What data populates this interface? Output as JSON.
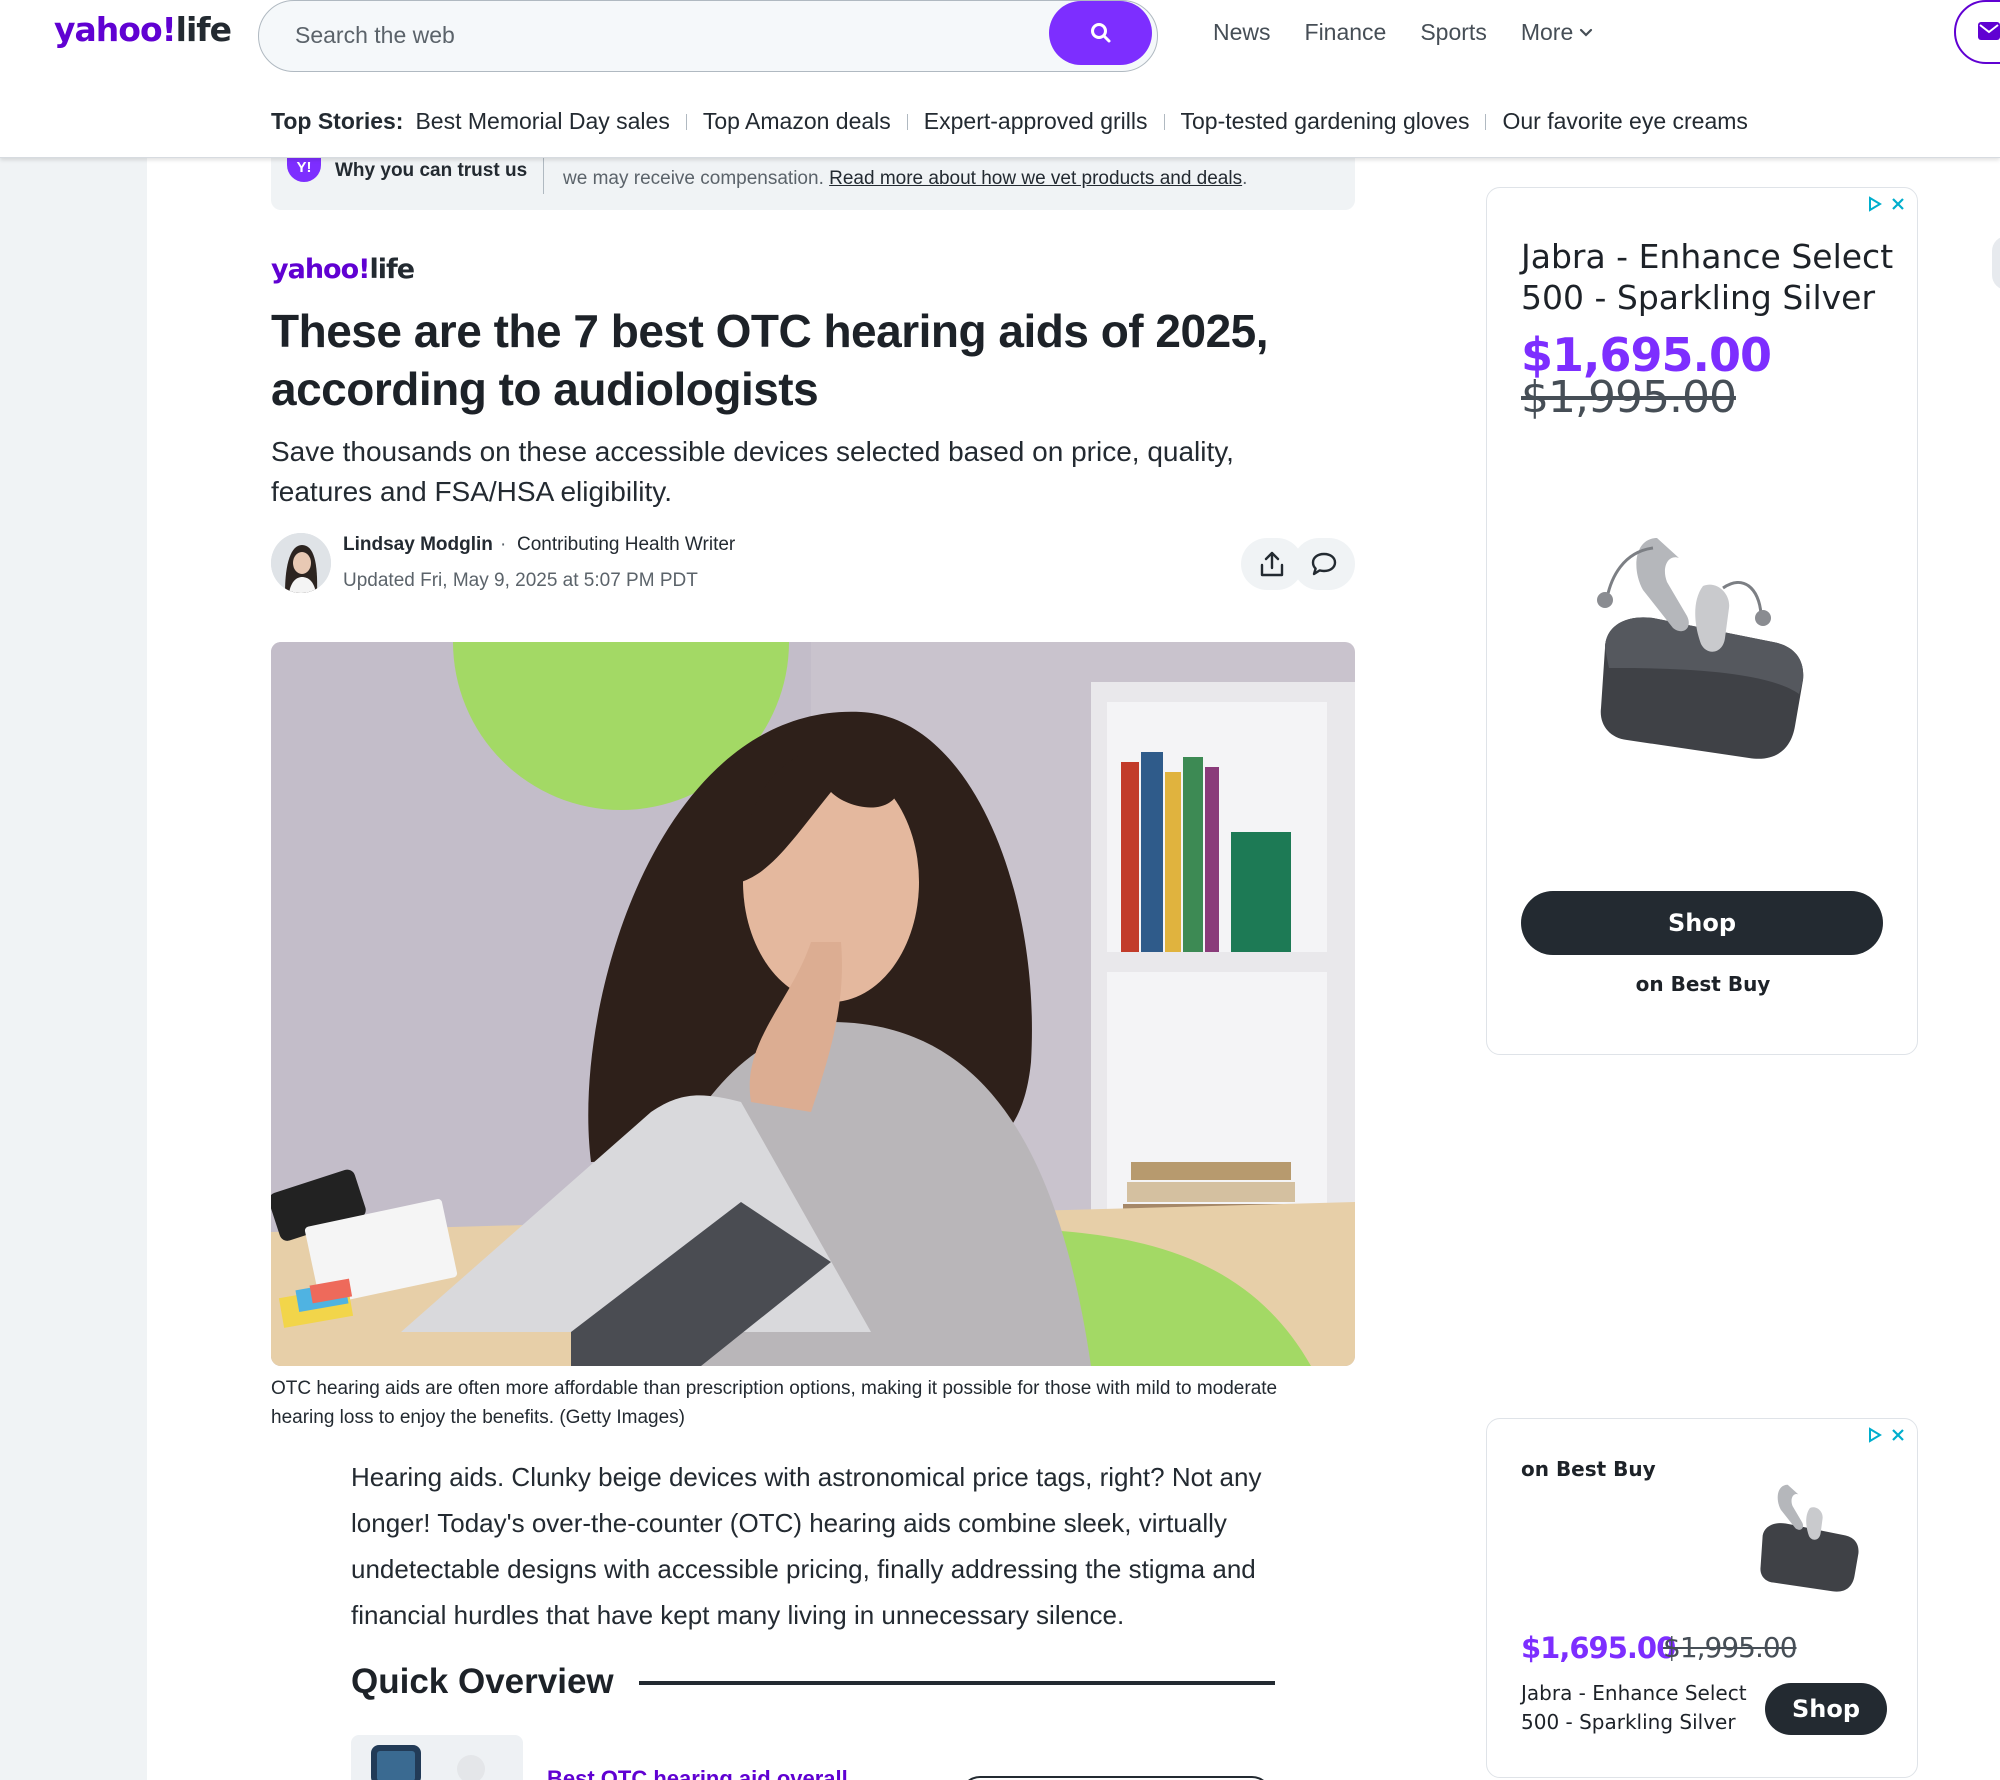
{
  "header": {
    "logo_main": "yahoo!",
    "logo_sub": "life",
    "search_placeholder": "Search the web",
    "nav": [
      "News",
      "Finance",
      "Sports",
      "More"
    ],
    "top_stories_label": "Top Stories:",
    "top_stories": [
      "Best Memorial Day sales",
      "Top Amazon deals",
      "Expert-approved grills",
      "Top-tested gardening gloves",
      "Our favorite eye creams"
    ]
  },
  "trust": {
    "badge": "Y!",
    "title": "Why you can trust us",
    "text": "we may receive compensation.",
    "link": "Read more about how we vet products and deals",
    "link_suffix": "."
  },
  "article": {
    "brand_main": "yahoo!",
    "brand_sub": "life",
    "headline": "These are the 7 best OTC hearing aids of 2025, according to audiologists",
    "subhead": "Save thousands on these accessible devices selected based on price, quality, features and FSA/HSA eligibility.",
    "author": "Lindsay Modglin",
    "author_sep": "·",
    "author_role": "Contributing Health Writer",
    "updated": "Updated Fri, May 9, 2025 at 5:07 PM PDT",
    "caption": "OTC hearing aids are often more affordable than prescription options, making it possible for those with mild to moderate hearing loss to enjoy the benefits. (Getty Images)",
    "body": "Hearing aids. Clunky beige devices with astronomical price tags, right? Not any longer! Today's over-the-counter (OTC) hearing aids combine sleek, virtually undetectable designs with accessible pricing, finally addressing the stigma and financial hurdles that have kept many living in unnecessary silence.",
    "quick_overview": "Quick Overview",
    "qo_link": "Best OTC hearing aid overall"
  },
  "ads": {
    "ad1": {
      "title": "Jabra - Enhance Select 500 - Sparkling Silver",
      "price": "$1,695.00",
      "old_price": "$1,995.00",
      "button": "Shop",
      "store": "on Best Buy"
    },
    "ad2": {
      "store": "on Best Buy",
      "price": "$1,695.00",
      "old_price": "$1,995.00",
      "title": "Jabra - Enhance Select 500 - Sparkling Silver",
      "button": "Shop"
    }
  },
  "colors": {
    "brand_purple": "#6001d2",
    "accent_purple": "#7d2eff",
    "dark": "#232a31",
    "hero_green": "#a3d965"
  }
}
